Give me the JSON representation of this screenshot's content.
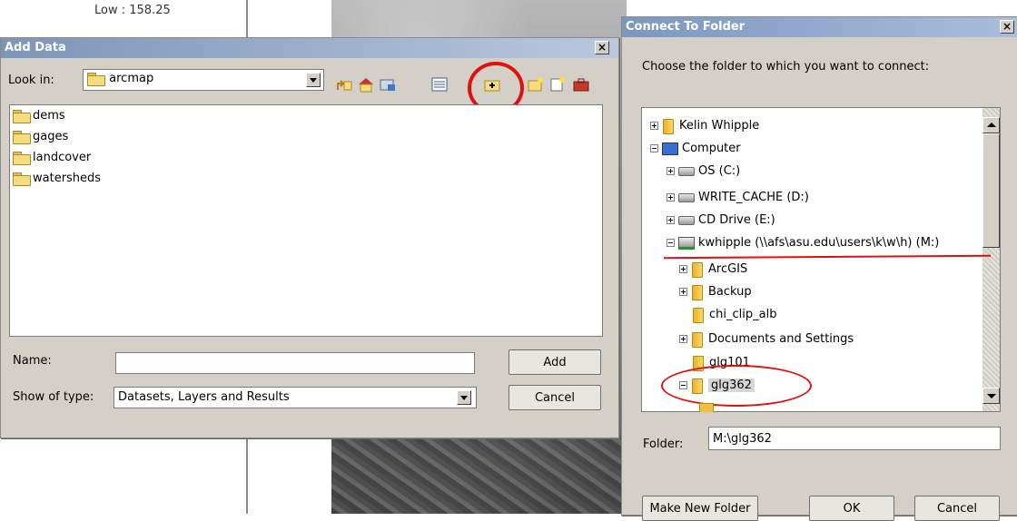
{
  "map": {
    "low_label": "Low : 158.25"
  },
  "add_data": {
    "title": "Add Data",
    "close": "×",
    "look_in_label": "Look in:",
    "look_in_value": "arcmap",
    "items": [
      "dems",
      "gages",
      "landcover",
      "watersheds"
    ],
    "name_label": "Name:",
    "name_value": "",
    "type_label": "Show of type:",
    "type_value": "Datasets, Layers and Results",
    "add_button": "Add",
    "cancel_button": "Cancel"
  },
  "connect": {
    "title": "Connect To Folder",
    "close": "×",
    "prompt": "Choose the folder to which you want to connect:",
    "tree": [
      {
        "label": "Kelin Whipple"
      },
      {
        "label": "Computer"
      },
      {
        "label": "OS (C:)"
      },
      {
        "label": "WRITE_CACHE (D:)"
      },
      {
        "label": "CD Drive (E:)"
      },
      {
        "label": "kwhipple (\\\\afs\\asu.edu\\users\\k\\w\\h) (M:)"
      },
      {
        "label": "ArcGIS"
      },
      {
        "label": "Backup"
      },
      {
        "label": "chi_clip_alb"
      },
      {
        "label": "Documents and Settings"
      },
      {
        "label": "glg101"
      },
      {
        "label": "glg362"
      }
    ],
    "folder_label": "Folder:",
    "folder_value": "M:\\glg362",
    "new_folder_button": "Make New Folder",
    "ok_button": "OK",
    "cancel_button": "Cancel"
  },
  "colors": {
    "annotation_red": "#e01010",
    "title_blue": "#7c97bf"
  }
}
